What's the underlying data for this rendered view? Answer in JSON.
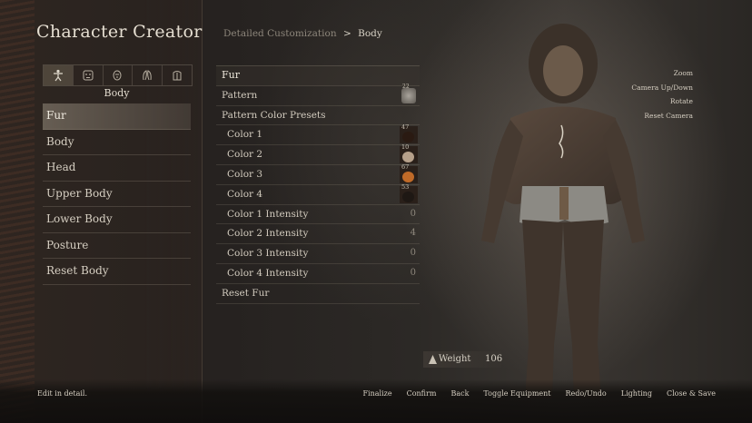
{
  "app": {
    "title": "Character Creator"
  },
  "sidebar": {
    "category_icons": [
      "body-figure-icon",
      "face-icon",
      "head-icon",
      "ears-icon",
      "torso-icon"
    ],
    "subtitle": "Body",
    "items": [
      {
        "label": "Fur",
        "active": true
      },
      {
        "label": "Body"
      },
      {
        "label": "Head"
      },
      {
        "label": "Upper Body"
      },
      {
        "label": "Lower Body"
      },
      {
        "label": "Posture"
      },
      {
        "label": "Reset Body"
      }
    ]
  },
  "breadcrumb": {
    "parent": "Detailed Customization",
    "separator": ">",
    "current": "Body"
  },
  "detail": {
    "header": "Fur",
    "pattern_label": "Pattern",
    "pattern_number": "22",
    "presets_label": "Pattern Color Presets",
    "colors": [
      {
        "label": "Color 1",
        "number": "47",
        "color": "#2a1a12"
      },
      {
        "label": "Color 2",
        "number": "10",
        "color": "#b6a08a"
      },
      {
        "label": "Color 3",
        "number": "67",
        "color": "#c06a28"
      },
      {
        "label": "Color 4",
        "number": "53",
        "color": "#1e1814"
      }
    ],
    "intensities": [
      {
        "label": "Color 1 Intensity",
        "value": "0"
      },
      {
        "label": "Color 2 Intensity",
        "value": "4"
      },
      {
        "label": "Color 3 Intensity",
        "value": "0"
      },
      {
        "label": "Color 4 Intensity",
        "value": "0"
      }
    ],
    "reset_label": "Reset Fur"
  },
  "camera": [
    "Zoom",
    "Camera Up/Down",
    "Rotate",
    "Reset Camera"
  ],
  "weight": {
    "label": "Weight",
    "value": "106"
  },
  "footer": {
    "hint": "Edit in detail.",
    "actions": [
      "Finalize",
      "Confirm",
      "Back",
      "Toggle Equipment",
      "Redo/Undo",
      "Lighting",
      "Close & Save"
    ]
  }
}
